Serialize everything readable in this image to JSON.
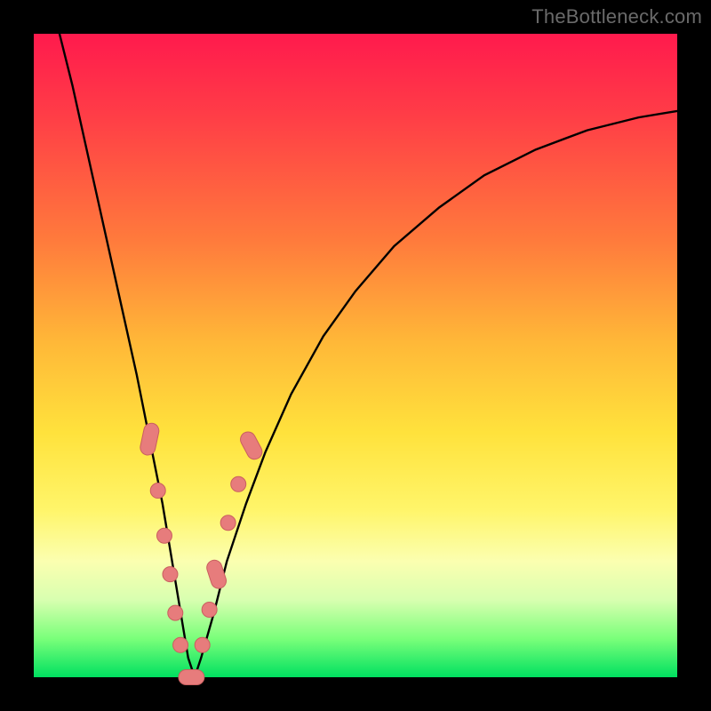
{
  "watermark": "TheBottleneck.com",
  "colors": {
    "curve": "#000000",
    "marker_fill": "#e77c7c",
    "marker_stroke": "#c95f5f",
    "background_top": "#ff1a4d",
    "background_bottom": "#00e060",
    "frame": "#000000"
  },
  "chart_data": {
    "type": "line",
    "title": "",
    "xlabel": "",
    "ylabel": "",
    "xlim": [
      0,
      100
    ],
    "ylim": [
      0,
      100
    ],
    "grid": false,
    "legend": false,
    "series": [
      {
        "name": "bottleneck-curve",
        "x": [
          4,
          6,
          8,
          10,
          12,
          14,
          16,
          18,
          20,
          21,
          22,
          23,
          24,
          25,
          26,
          28,
          30,
          33,
          36,
          40,
          45,
          50,
          56,
          63,
          70,
          78,
          86,
          94,
          100
        ],
        "y": [
          100,
          92,
          83,
          74,
          65,
          56,
          47,
          37,
          27,
          21,
          15,
          9,
          3,
          0,
          3,
          10,
          18,
          27,
          35,
          44,
          53,
          60,
          67,
          73,
          78,
          82,
          85,
          87,
          88
        ]
      }
    ],
    "markers": [
      {
        "x": 18.0,
        "y": 37.0,
        "capsule": true,
        "len": 5.0,
        "angle": -78
      },
      {
        "x": 19.3,
        "y": 29.0
      },
      {
        "x": 20.3,
        "y": 22.0
      },
      {
        "x": 21.2,
        "y": 16.0
      },
      {
        "x": 22.0,
        "y": 10.0
      },
      {
        "x": 22.8,
        "y": 5.0
      },
      {
        "x": 24.5,
        "y": 0.0,
        "capsule": true,
        "len": 4.0,
        "angle": 0
      },
      {
        "x": 26.2,
        "y": 5.0
      },
      {
        "x": 27.3,
        "y": 10.5
      },
      {
        "x": 28.4,
        "y": 16.0,
        "capsule": true,
        "len": 4.5,
        "angle": 72
      },
      {
        "x": 30.2,
        "y": 24.0
      },
      {
        "x": 31.8,
        "y": 30.0
      },
      {
        "x": 33.8,
        "y": 36.0,
        "capsule": true,
        "len": 4.5,
        "angle": 62
      }
    ],
    "notes": "V-shaped bottleneck curve. Minimum near x≈25, y≈0. Background gradient encodes severity from red (high) to green (low). Pink capsule/dot markers cluster along the lower portion of both arms near the minimum."
  }
}
